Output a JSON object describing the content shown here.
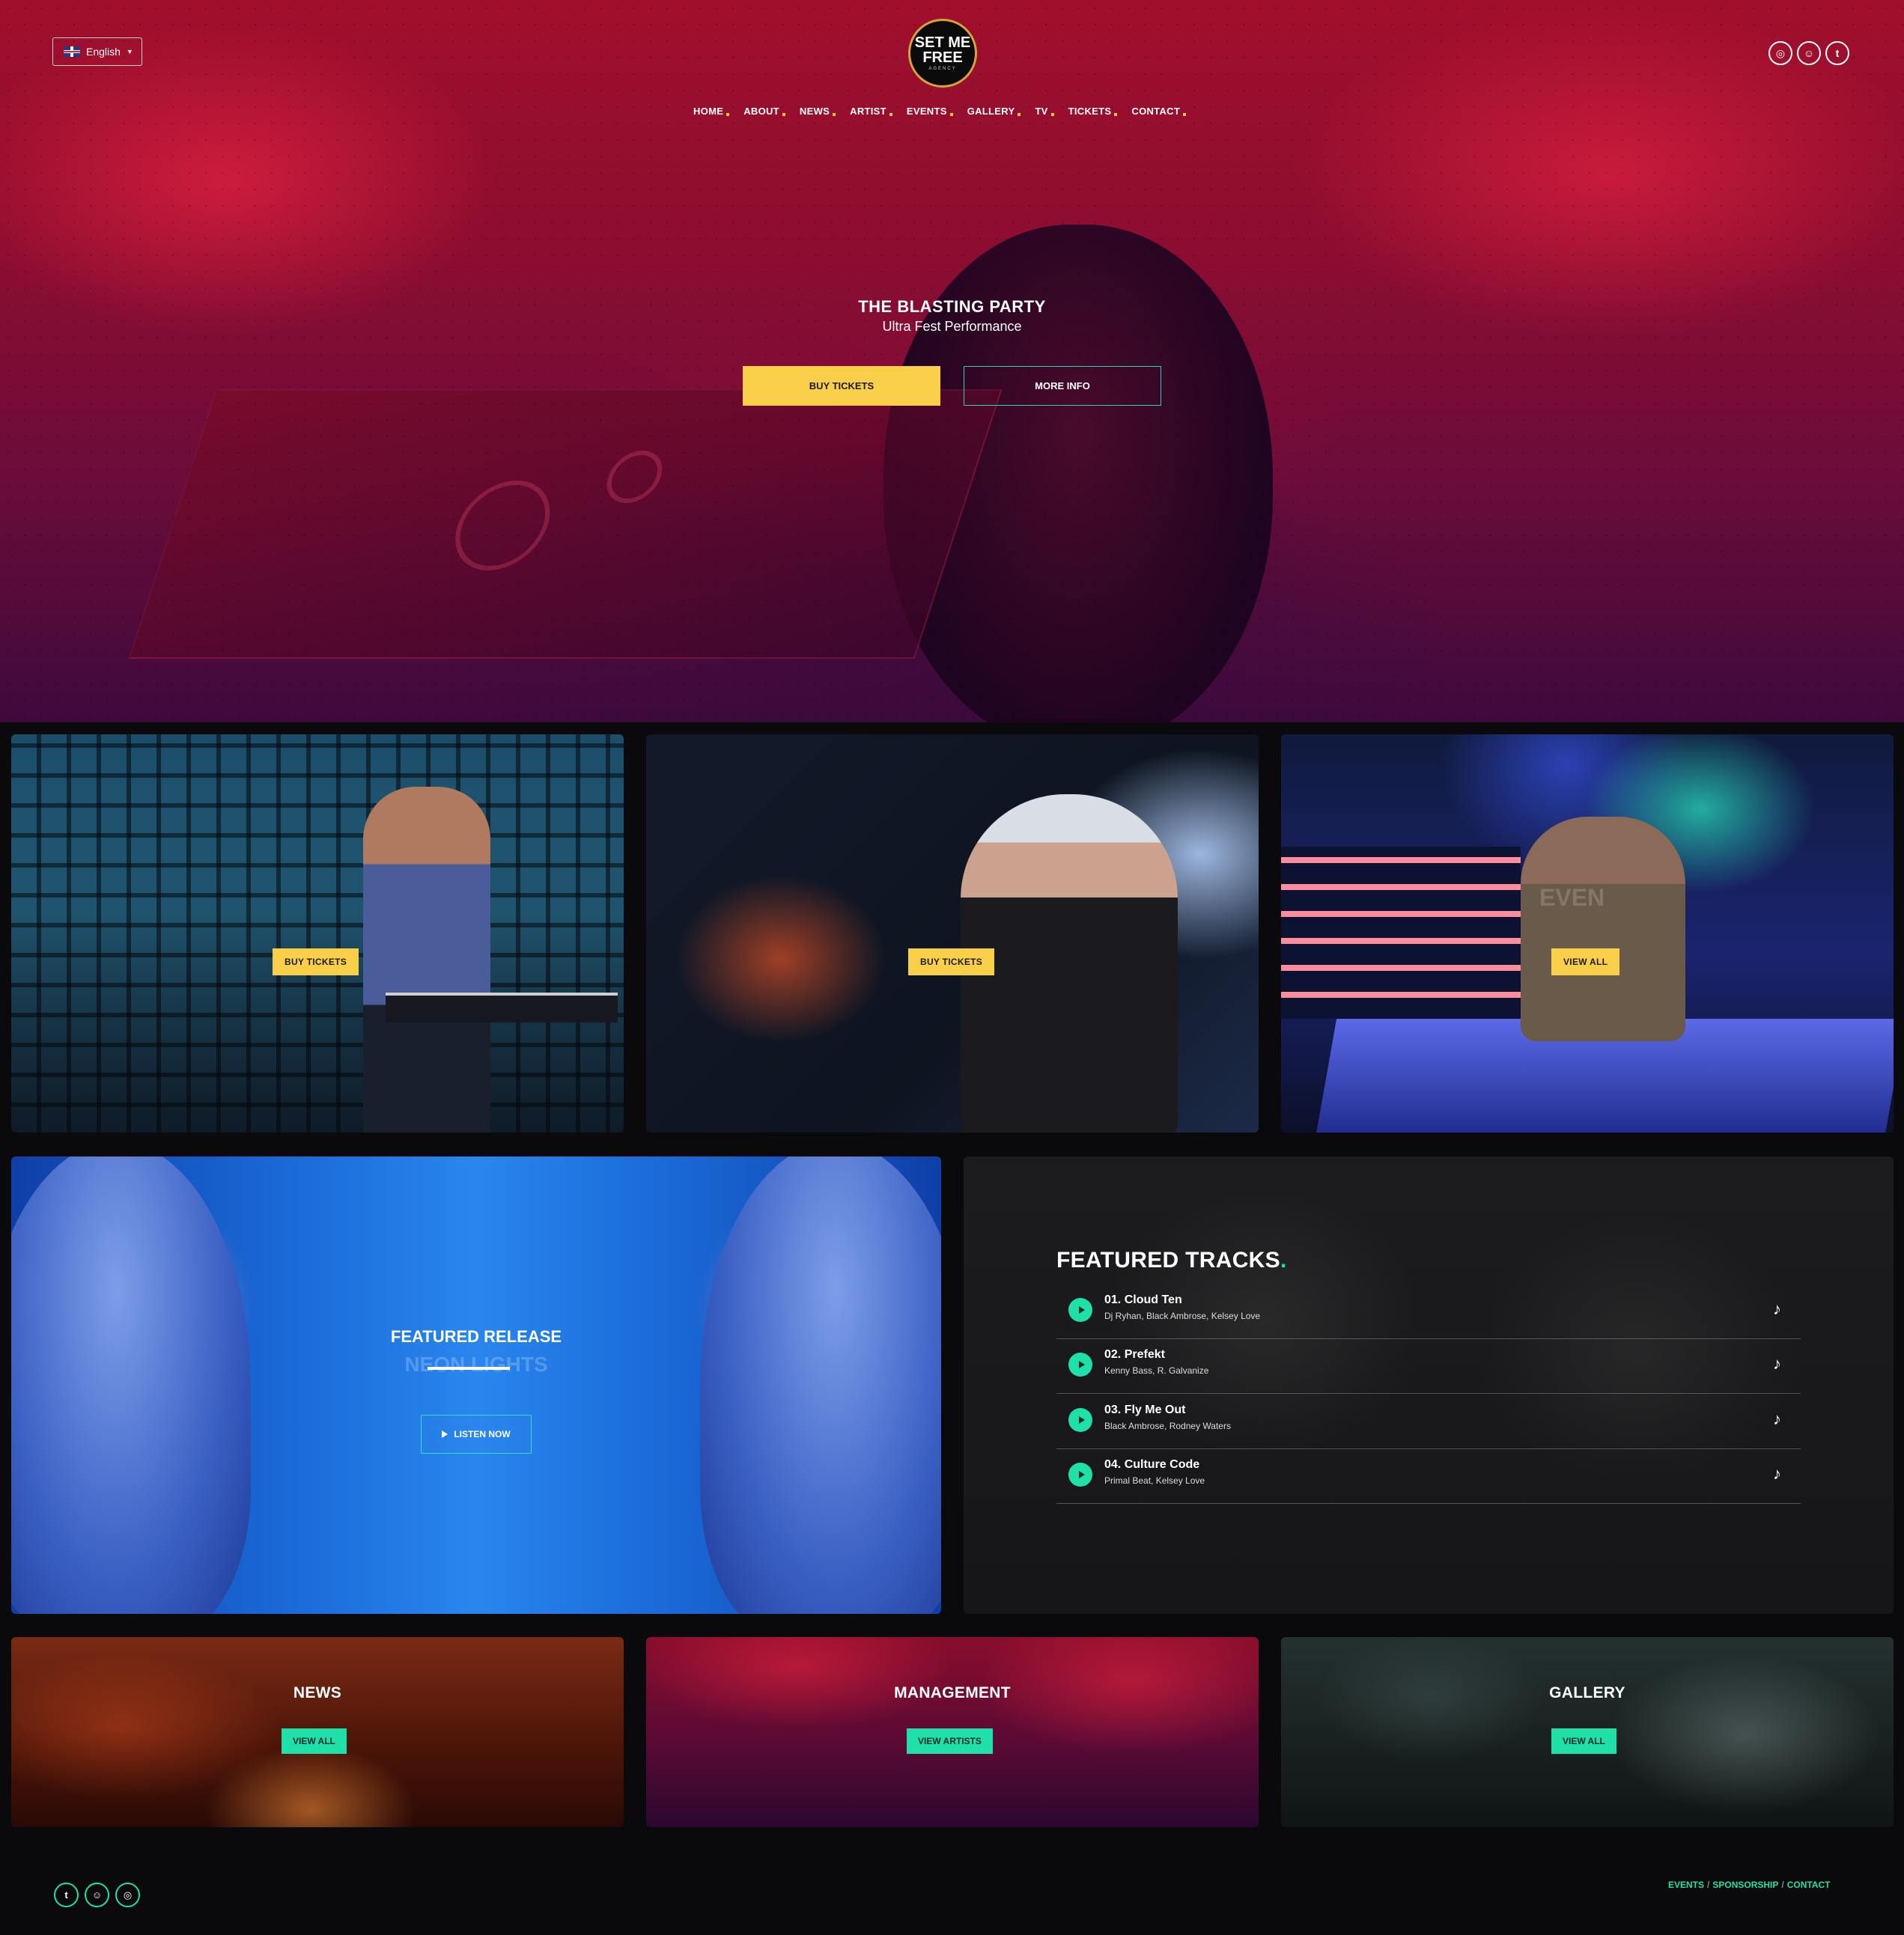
{
  "header": {
    "language": "English",
    "logo": {
      "line1": "SET ME",
      "line2": "FREE",
      "line3": "AGENCY"
    },
    "nav": [
      "HOME",
      "ABOUT",
      "NEWS",
      "ARTIST",
      "EVENTS",
      "GALLERY",
      "TV",
      "TICKETS",
      "CONTACT"
    ],
    "social": [
      {
        "icon": "instagram-icon",
        "glyph": "◎"
      },
      {
        "icon": "snapchat-icon",
        "glyph": "☺"
      },
      {
        "icon": "twitter-icon",
        "glyph": "t"
      }
    ]
  },
  "hero": {
    "title": "THE BLASTING PARTY",
    "subtitle": "Ultra Fest Performance",
    "buy_label": "BUY TICKETS",
    "more_label": "MORE INFO"
  },
  "cards": [
    {
      "button": "BUY TICKETS"
    },
    {
      "button": "BUY TICKETS"
    },
    {
      "button": "VIEW ALL",
      "ghost": "EVEN"
    }
  ],
  "release": {
    "label": "FEATURED RELEASE",
    "name": "NEON LIGHTS",
    "listen_label": "LISTEN NOW"
  },
  "tracks": {
    "title": "FEATURED TRACKS",
    "items": [
      {
        "name": "01. Cloud Ten",
        "artists": "Dj Ryhan, Black Ambrose, Kelsey Love"
      },
      {
        "name": "02. Prefekt",
        "artists": "Kenny Bass, R. Galvanize"
      },
      {
        "name": "03. Fly Me Out",
        "artists": "Black Ambrose, Rodney Waters"
      },
      {
        "name": "04. Culture Code",
        "artists": "Primal Beat, Kelsey Love"
      }
    ]
  },
  "tiles": [
    {
      "title": "NEWS",
      "button": "VIEW ALL"
    },
    {
      "title": "MANAGEMENT",
      "button": "VIEW ARTISTS"
    },
    {
      "title": "GALLERY",
      "button": "VIEW ALL"
    }
  ],
  "footer": {
    "social": [
      {
        "icon": "twitter-icon",
        "glyph": "t"
      },
      {
        "icon": "snapchat-icon",
        "glyph": "☺"
      },
      {
        "icon": "instagram-icon",
        "glyph": "◎"
      }
    ],
    "links": [
      "EVENTS",
      "SPONSORSHIP",
      "CONTACT"
    ]
  },
  "colors": {
    "accent_yellow": "#f9cf4a",
    "accent_green": "#1fe0a8",
    "hero_red": "#a10f2c",
    "teal_border": "#2bd4b8"
  }
}
